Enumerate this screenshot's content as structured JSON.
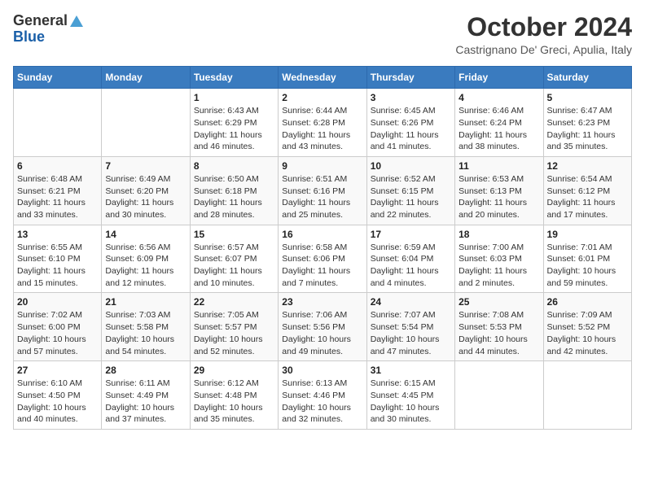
{
  "logo": {
    "general": "General",
    "blue": "Blue"
  },
  "title": "October 2024",
  "subtitle": "Castrignano De' Greci, Apulia, Italy",
  "headers": [
    "Sunday",
    "Monday",
    "Tuesday",
    "Wednesday",
    "Thursday",
    "Friday",
    "Saturday"
  ],
  "weeks": [
    [
      {
        "day": "",
        "info": ""
      },
      {
        "day": "",
        "info": ""
      },
      {
        "day": "1",
        "info": "Sunrise: 6:43 AM\nSunset: 6:29 PM\nDaylight: 11 hours and 46 minutes."
      },
      {
        "day": "2",
        "info": "Sunrise: 6:44 AM\nSunset: 6:28 PM\nDaylight: 11 hours and 43 minutes."
      },
      {
        "day": "3",
        "info": "Sunrise: 6:45 AM\nSunset: 6:26 PM\nDaylight: 11 hours and 41 minutes."
      },
      {
        "day": "4",
        "info": "Sunrise: 6:46 AM\nSunset: 6:24 PM\nDaylight: 11 hours and 38 minutes."
      },
      {
        "day": "5",
        "info": "Sunrise: 6:47 AM\nSunset: 6:23 PM\nDaylight: 11 hours and 35 minutes."
      }
    ],
    [
      {
        "day": "6",
        "info": "Sunrise: 6:48 AM\nSunset: 6:21 PM\nDaylight: 11 hours and 33 minutes."
      },
      {
        "day": "7",
        "info": "Sunrise: 6:49 AM\nSunset: 6:20 PM\nDaylight: 11 hours and 30 minutes."
      },
      {
        "day": "8",
        "info": "Sunrise: 6:50 AM\nSunset: 6:18 PM\nDaylight: 11 hours and 28 minutes."
      },
      {
        "day": "9",
        "info": "Sunrise: 6:51 AM\nSunset: 6:16 PM\nDaylight: 11 hours and 25 minutes."
      },
      {
        "day": "10",
        "info": "Sunrise: 6:52 AM\nSunset: 6:15 PM\nDaylight: 11 hours and 22 minutes."
      },
      {
        "day": "11",
        "info": "Sunrise: 6:53 AM\nSunset: 6:13 PM\nDaylight: 11 hours and 20 minutes."
      },
      {
        "day": "12",
        "info": "Sunrise: 6:54 AM\nSunset: 6:12 PM\nDaylight: 11 hours and 17 minutes."
      }
    ],
    [
      {
        "day": "13",
        "info": "Sunrise: 6:55 AM\nSunset: 6:10 PM\nDaylight: 11 hours and 15 minutes."
      },
      {
        "day": "14",
        "info": "Sunrise: 6:56 AM\nSunset: 6:09 PM\nDaylight: 11 hours and 12 minutes."
      },
      {
        "day": "15",
        "info": "Sunrise: 6:57 AM\nSunset: 6:07 PM\nDaylight: 11 hours and 10 minutes."
      },
      {
        "day": "16",
        "info": "Sunrise: 6:58 AM\nSunset: 6:06 PM\nDaylight: 11 hours and 7 minutes."
      },
      {
        "day": "17",
        "info": "Sunrise: 6:59 AM\nSunset: 6:04 PM\nDaylight: 11 hours and 4 minutes."
      },
      {
        "day": "18",
        "info": "Sunrise: 7:00 AM\nSunset: 6:03 PM\nDaylight: 11 hours and 2 minutes."
      },
      {
        "day": "19",
        "info": "Sunrise: 7:01 AM\nSunset: 6:01 PM\nDaylight: 10 hours and 59 minutes."
      }
    ],
    [
      {
        "day": "20",
        "info": "Sunrise: 7:02 AM\nSunset: 6:00 PM\nDaylight: 10 hours and 57 minutes."
      },
      {
        "day": "21",
        "info": "Sunrise: 7:03 AM\nSunset: 5:58 PM\nDaylight: 10 hours and 54 minutes."
      },
      {
        "day": "22",
        "info": "Sunrise: 7:05 AM\nSunset: 5:57 PM\nDaylight: 10 hours and 52 minutes."
      },
      {
        "day": "23",
        "info": "Sunrise: 7:06 AM\nSunset: 5:56 PM\nDaylight: 10 hours and 49 minutes."
      },
      {
        "day": "24",
        "info": "Sunrise: 7:07 AM\nSunset: 5:54 PM\nDaylight: 10 hours and 47 minutes."
      },
      {
        "day": "25",
        "info": "Sunrise: 7:08 AM\nSunset: 5:53 PM\nDaylight: 10 hours and 44 minutes."
      },
      {
        "day": "26",
        "info": "Sunrise: 7:09 AM\nSunset: 5:52 PM\nDaylight: 10 hours and 42 minutes."
      }
    ],
    [
      {
        "day": "27",
        "info": "Sunrise: 6:10 AM\nSunset: 4:50 PM\nDaylight: 10 hours and 40 minutes."
      },
      {
        "day": "28",
        "info": "Sunrise: 6:11 AM\nSunset: 4:49 PM\nDaylight: 10 hours and 37 minutes."
      },
      {
        "day": "29",
        "info": "Sunrise: 6:12 AM\nSunset: 4:48 PM\nDaylight: 10 hours and 35 minutes."
      },
      {
        "day": "30",
        "info": "Sunrise: 6:13 AM\nSunset: 4:46 PM\nDaylight: 10 hours and 32 minutes."
      },
      {
        "day": "31",
        "info": "Sunrise: 6:15 AM\nSunset: 4:45 PM\nDaylight: 10 hours and 30 minutes."
      },
      {
        "day": "",
        "info": ""
      },
      {
        "day": "",
        "info": ""
      }
    ]
  ]
}
